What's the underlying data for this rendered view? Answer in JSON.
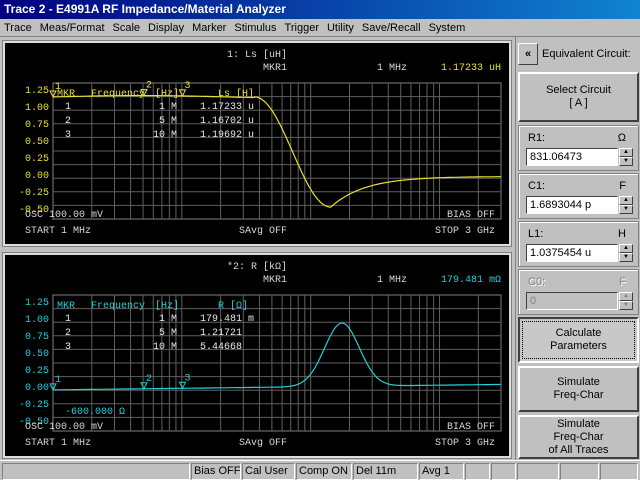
{
  "window": {
    "title": "Trace 2 - E4991A RF Impedance/Material Analyzer"
  },
  "menu": [
    "Trace",
    "Meas/Format",
    "Scale",
    "Display",
    "Marker",
    "Stimulus",
    "Trigger",
    "Utility",
    "Save/Recall",
    "System"
  ],
  "trace1": {
    "title": "1: Ls [uH]",
    "marker_label": "MKR1",
    "marker_freq": "1 MHz",
    "marker_value": "1.17233 uH",
    "color": "#e8e030",
    "y_ticks": [
      "1.25",
      "1.00",
      "0.75",
      "0.50",
      "0.25",
      "0.00",
      "-0.25",
      "-0.50"
    ],
    "table_header": [
      "MKR",
      "Frequency",
      "[Hz]",
      "Ls [H]"
    ],
    "table_rows": [
      {
        "n": "1",
        "freq": "1 M",
        "val": "1.17233 u"
      },
      {
        "n": "2",
        "freq": "5 M",
        "val": "1.16702 u"
      },
      {
        "n": "3",
        "freq": "10 M",
        "val": "1.19692 u"
      }
    ],
    "marker_tags": [
      "1",
      "2",
      "3"
    ],
    "osc": "OSC 100.00 mV",
    "bias": "BIAS OFF",
    "start": "START  1 MHz",
    "savg": "SAvg OFF",
    "stop": "STOP  3 GHz"
  },
  "trace2": {
    "title": "*2: R [kΩ]",
    "marker_label": "MKR1",
    "marker_freq": "1 MHz",
    "marker_value": "179.481 mΩ",
    "color": "#20d0d8",
    "y_ticks": [
      "1.25",
      "1.00",
      "0.75",
      "0.50",
      "0.25",
      "0.00",
      "-0.25",
      "-0.50"
    ],
    "table_header": [
      "MKR",
      "Frequency",
      "[Hz]",
      "R [Ω]"
    ],
    "table_rows": [
      {
        "n": "1",
        "freq": "1 M",
        "val": "179.481 m"
      },
      {
        "n": "2",
        "freq": "5 M",
        "val": "1.21721"
      },
      {
        "n": "3",
        "freq": "10 M",
        "val": "5.44668"
      }
    ],
    "marker_tags": [
      "1",
      "2",
      "3"
    ],
    "ref_value": "-600.000 Ω",
    "osc": "OSC 100.00 mV",
    "bias": "BIAS OFF",
    "start": "START  1 MHz",
    "savg": "SAvg OFF",
    "stop": "STOP  3 GHz"
  },
  "side": {
    "header": "Equivalent Circuit:",
    "back_glyph": "«",
    "select_circuit": [
      "Select Circuit",
      "[ A ]"
    ],
    "fields": [
      {
        "label": "R1:",
        "unit": "Ω",
        "value": "831.06473",
        "enabled": true
      },
      {
        "label": "C1:",
        "unit": "F",
        "value": "1.6893044 p",
        "enabled": true
      },
      {
        "label": "L1:",
        "unit": "H",
        "value": "1.0375454 u",
        "enabled": true
      },
      {
        "label": "C0:",
        "unit": "F",
        "value": "0",
        "enabled": false
      }
    ],
    "calculate": [
      "Calculate",
      "Parameters"
    ],
    "simulate": [
      "Simulate",
      "Freq-Char"
    ],
    "simulate_all": [
      "Simulate",
      "Freq-Char",
      "of All Traces"
    ]
  },
  "status": [
    "Bias OFF",
    "Cal User",
    "Comp ON",
    "Del 11m",
    "Avg  1"
  ]
}
